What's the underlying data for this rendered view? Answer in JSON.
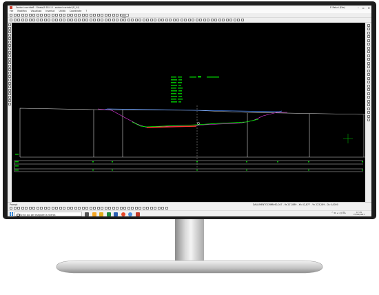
{
  "window": {
    "title": "Sezioni corridoi6 - Strato/9 18.4.0 - sezioni corridoi (R_LU)",
    "user": "P. Paturi (Eds)",
    "controls": [
      "minimize-icon",
      "maximize-icon",
      "close-icon"
    ]
  },
  "menu": {
    "items": [
      "File",
      "Modifica",
      "Visualizza",
      "Inserisci",
      "Utilità",
      "Coordinate",
      "?"
    ]
  },
  "toolbar": {
    "zoom_value": "stck 270"
  },
  "canvas": {
    "background_color": "#000000",
    "annotation_color": "#00c800",
    "cursor_color": "#00b000",
    "section_line_color": "#e0e0e0",
    "profile_design_color": "#00ff00",
    "profile_ground_color": "#ff3333",
    "profile_offset_color": "#ff40ff"
  },
  "statusbar": {
    "prompt": "Prompt",
    "unit": "DALLIMENTOCMM",
    "coords": "N     60,047 - Ya     227,889 - Xh     42,877 - Yn     223,289 - Ds     0,0000"
  },
  "taskbar": {
    "search_placeholder": "Scrivi qui per eseguire la ricerca",
    "time": "17:15",
    "date": "27/09/2021",
    "tray": "^ ⊡ ⊿ ◁) ITA",
    "app_colors": [
      "#555555",
      "#f5a623",
      "#e0ac1a",
      "#1a8a3a",
      "#2b5fb3",
      "#e84a2a",
      "#4a90e2",
      "#c23b2a"
    ]
  }
}
